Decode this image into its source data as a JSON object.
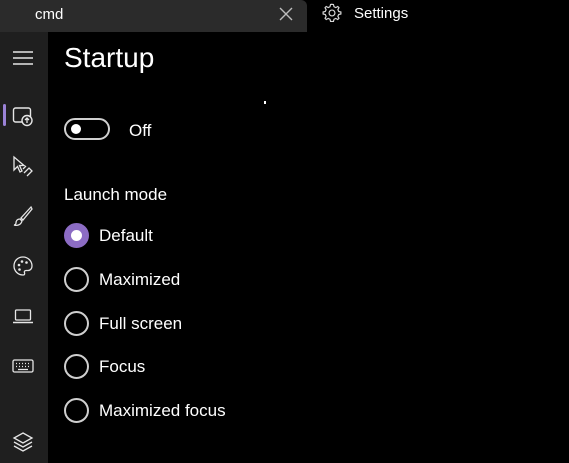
{
  "tabs": {
    "terminal_tab_label": "cmd",
    "close_icon": "close-icon",
    "settings_tab_label": "Settings",
    "settings_icon": "gear-icon"
  },
  "sidebar": {
    "items": [
      {
        "name": "hamburger-menu-icon",
        "active": false
      },
      {
        "name": "startup-icon",
        "active": true
      },
      {
        "name": "interaction-icon",
        "active": false
      },
      {
        "name": "appearance-brush-icon",
        "active": false
      },
      {
        "name": "color-schemes-palette-icon",
        "active": false
      },
      {
        "name": "rendering-laptop-icon",
        "active": false
      },
      {
        "name": "actions-keyboard-icon",
        "active": false
      },
      {
        "name": "profiles-layers-icon",
        "active": false
      }
    ]
  },
  "main": {
    "title": "Startup",
    "toggle": {
      "state_label": "Off",
      "on": false
    },
    "launch_mode": {
      "label": "Launch mode",
      "options": [
        {
          "label": "Default",
          "selected": true
        },
        {
          "label": "Maximized",
          "selected": false
        },
        {
          "label": "Full screen",
          "selected": false
        },
        {
          "label": "Focus",
          "selected": false
        },
        {
          "label": "Maximized focus",
          "selected": false
        }
      ]
    }
  },
  "colors": {
    "background": "#000000",
    "sidebar": "#1f1f1f",
    "tab": "#2b2b2b",
    "accent": "#8c6cc4",
    "text": "#ffffff"
  }
}
